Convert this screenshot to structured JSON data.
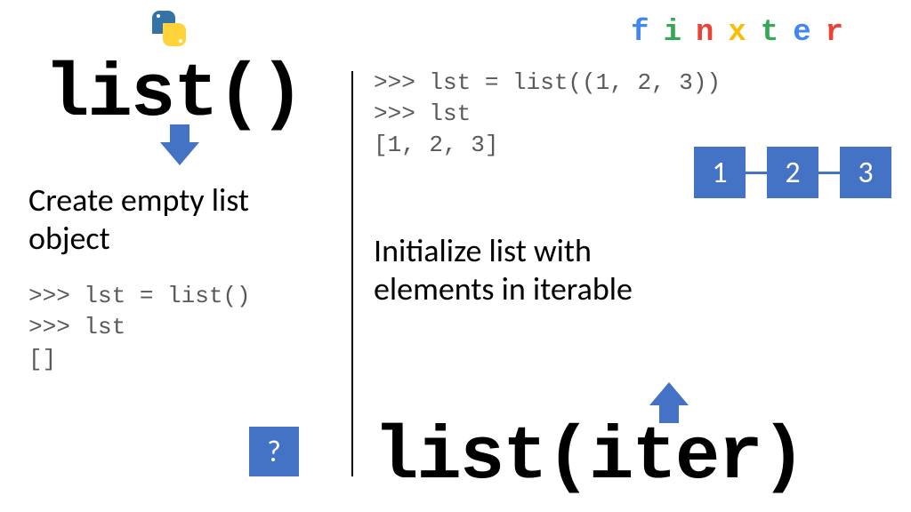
{
  "logo": {
    "finxter": {
      "f": "f",
      "i": "i",
      "n": "n",
      "x": "x",
      "t": "t",
      "e": "e",
      "r": "r"
    }
  },
  "left": {
    "title": "list()",
    "desc": "Create empty list\nobject",
    "code": ">>> lst = list()\n>>> lst\n[]",
    "question": "?"
  },
  "right": {
    "code": ">>> lst = list((1, 2, 3))\n>>> lst\n[1, 2, 3]",
    "desc": "Initialize list with\nelements in iterable",
    "title": "list(iter)",
    "nodes": [
      "1",
      "2",
      "3"
    ]
  }
}
